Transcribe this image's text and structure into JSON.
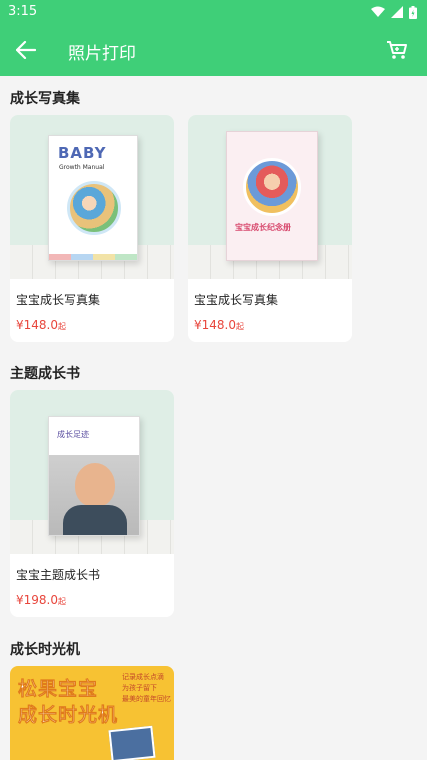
{
  "status_bar": {
    "time": "3:15"
  },
  "app_bar": {
    "title": "照片打印"
  },
  "sections": [
    {
      "title": "成长写真集"
    },
    {
      "title": "主题成长书"
    },
    {
      "title": "成长时光机"
    }
  ],
  "products": [
    {
      "name": "宝宝成长写真集",
      "price": "¥148.0",
      "price_suffix": "起",
      "cover_title": "BABY",
      "cover_subtitle": "Growth Manual"
    },
    {
      "name": "宝宝成长写真集",
      "price": "¥148.0",
      "price_suffix": "起",
      "cover_title": "宝宝成长纪念册"
    },
    {
      "name": "宝宝主题成长书",
      "price": "¥198.0",
      "price_suffix": "起",
      "cover_title": "成长足迹"
    }
  ],
  "banner": {
    "line1": "松果宝宝",
    "line2": "成长时光机",
    "side_lines": [
      "记录成长点滴",
      "为孩子留下",
      "最美的童年回忆"
    ]
  },
  "colors": {
    "primary": "#3fcf78",
    "price": "#e8463c",
    "banner": "#f7c233"
  }
}
